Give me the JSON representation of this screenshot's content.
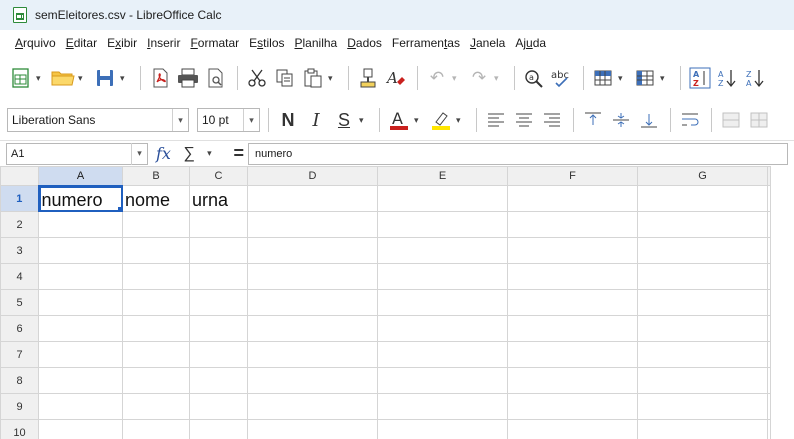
{
  "window": {
    "title": "semEleitores.csv - LibreOffice Calc"
  },
  "menu": [
    {
      "first": "A",
      "rest": "rquivo"
    },
    {
      "first": "E",
      "rest": "ditar"
    },
    {
      "pre": "E",
      "first": "x",
      "rest": "ibir"
    },
    {
      "first": "I",
      "rest": "nserir"
    },
    {
      "first": "F",
      "rest": "ormatar"
    },
    {
      "pre": "E",
      "first": "s",
      "rest": "tilos"
    },
    {
      "first": "P",
      "rest": "lanilha"
    },
    {
      "first": "D",
      "rest": "ados"
    },
    {
      "pre": "Ferramen",
      "first": "t",
      "rest": "as"
    },
    {
      "first": "J",
      "rest": "anela"
    },
    {
      "pre": "Aj",
      "first": "u",
      "rest": "da"
    }
  ],
  "format": {
    "font_name": "Liberation Sans",
    "font_size": "10 pt"
  },
  "formula_bar": {
    "name_box": "A1",
    "content": "numero"
  },
  "sheet": {
    "columns": [
      "A",
      "B",
      "C",
      "D",
      "E",
      "F",
      "G"
    ],
    "rows": [
      [
        "numero",
        "nome",
        "urna",
        "",
        "",
        "",
        ""
      ],
      [
        "",
        "",
        "",
        "",
        "",
        "",
        ""
      ],
      [
        "",
        "",
        "",
        "",
        "",
        "",
        ""
      ],
      [
        "",
        "",
        "",
        "",
        "",
        "",
        ""
      ],
      [
        "",
        "",
        "",
        "",
        "",
        "",
        ""
      ],
      [
        "",
        "",
        "",
        "",
        "",
        "",
        ""
      ],
      [
        "",
        "",
        "",
        "",
        "",
        "",
        ""
      ],
      [
        "",
        "",
        "",
        "",
        "",
        "",
        ""
      ],
      [
        "",
        "",
        "",
        "",
        "",
        "",
        ""
      ],
      [
        "",
        "",
        "",
        "",
        "",
        "",
        ""
      ]
    ],
    "row_labels": [
      "1",
      "2",
      "3",
      "4",
      "5",
      "6",
      "7",
      "8",
      "9",
      "10"
    ],
    "selected_cell": "A1"
  },
  "colors": {
    "accent": "#1f5fbf",
    "titlebar": "#e8f1f9",
    "header_bg": "#f0f0f0",
    "font_color_bar": "#c9211e",
    "highlight_bar": "#ffe600"
  }
}
